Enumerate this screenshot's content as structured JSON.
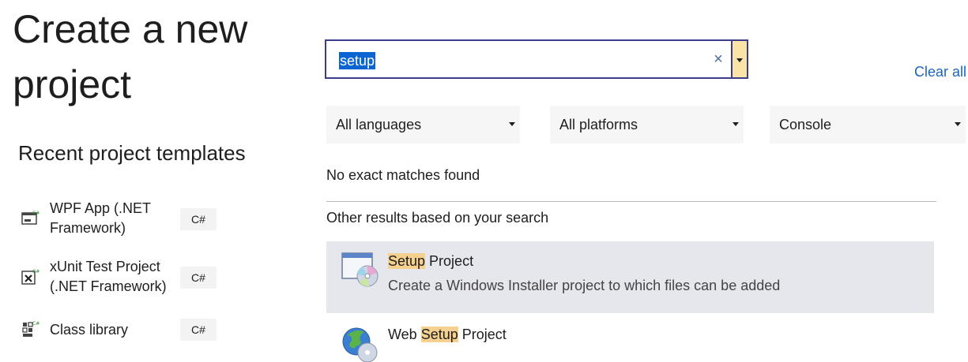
{
  "page": {
    "title": "Create a new project",
    "recent_heading": "Recent project templates"
  },
  "recent_templates": [
    {
      "label": "WPF App (.NET Framework)",
      "lang": "C#",
      "icon": "wpf-app-icon"
    },
    {
      "label": "xUnit Test Project (.NET Framework)",
      "lang": "C#",
      "icon": "xunit-test-icon"
    },
    {
      "label": "Class library",
      "lang": "C#",
      "icon": "class-library-icon"
    }
  ],
  "search": {
    "value": "setup",
    "clear_glyph": "×",
    "clear_all": "Clear all"
  },
  "filters": {
    "language": "All languages",
    "platform": "All platforms",
    "project_type": "Console"
  },
  "results": {
    "no_match": "No exact matches found",
    "other_results": "Other results based on your search",
    "items": [
      {
        "title_highlight": "Setup",
        "title_rest": " Project",
        "description": "Create a Windows Installer project to which files can be added",
        "selected": true
      },
      {
        "title_prefix": "Web ",
        "title_highlight": "Setup",
        "title_rest": " Project"
      }
    ]
  },
  "colors": {
    "accent_link": "#1a65c0",
    "search_border": "#3c3c8a",
    "selection_bg": "#e6e7ed",
    "highlight": "#f6d08f"
  }
}
